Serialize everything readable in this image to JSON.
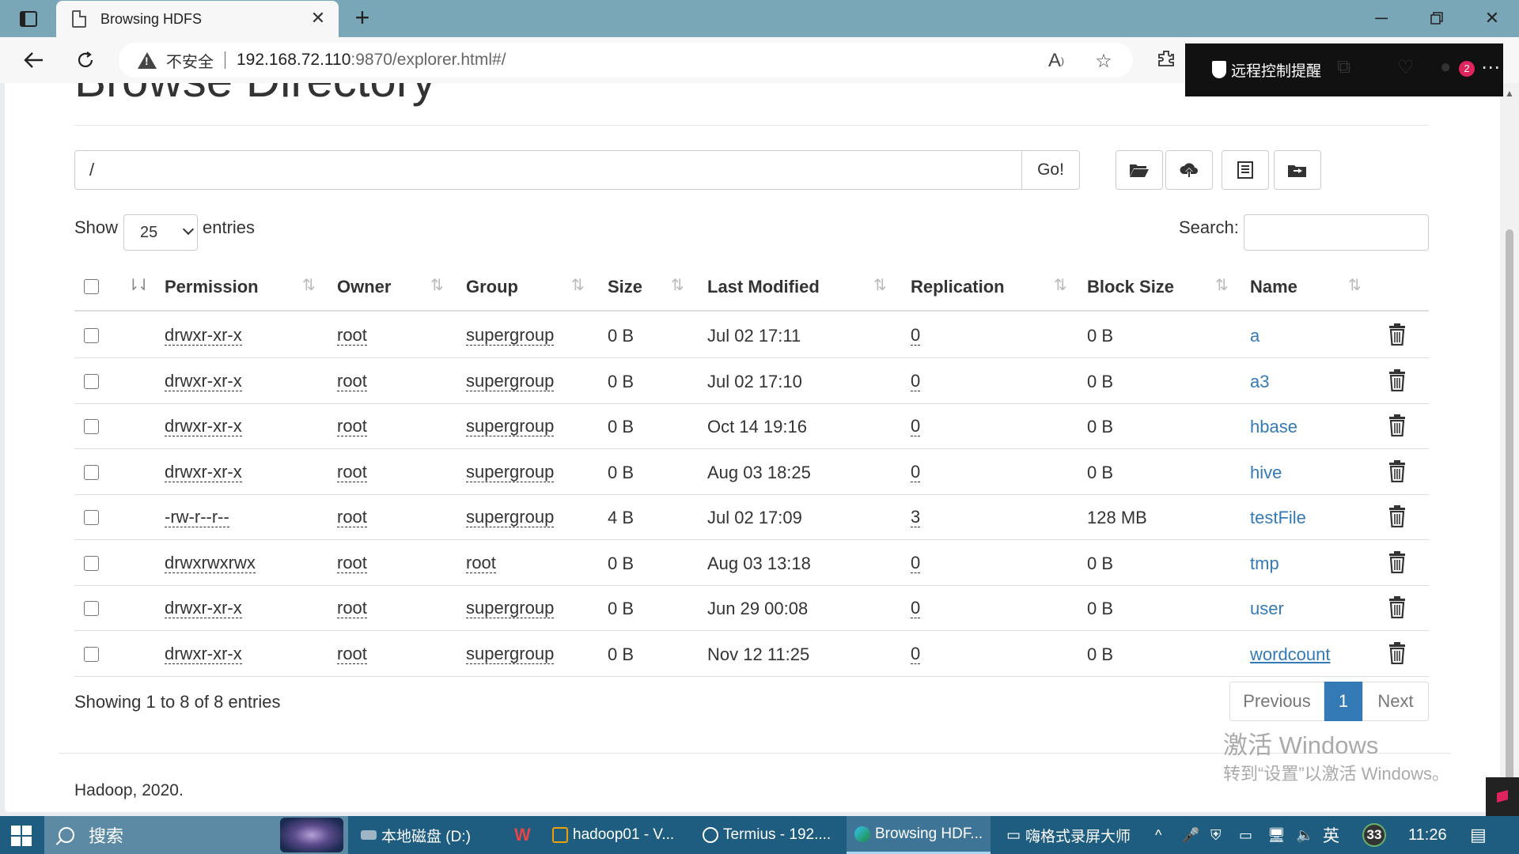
{
  "browser": {
    "tab_title": "Browsing HDFS",
    "insecure_label": "不安全",
    "url_host": "192.168.72.110",
    "url_rest": ":9870/explorer.html#/",
    "remote_toast": "远程控制提醒",
    "notif_count": "2"
  },
  "page": {
    "title": "Browse Directory",
    "path_value": "/",
    "go_label": "Go!",
    "show_label": "Show",
    "page_size": "25",
    "entries_label": "entries",
    "search_label": "Search:",
    "search_value": "",
    "columns": [
      "Permission",
      "Owner",
      "Group",
      "Size",
      "Last Modified",
      "Replication",
      "Block Size",
      "Name"
    ],
    "rows": [
      {
        "permission": "drwxr-xr-x",
        "owner": "root",
        "group": "supergroup",
        "size": "0 B",
        "modified": "Jul 02 17:11",
        "replication": "0",
        "block_size": "0 B",
        "name": "a"
      },
      {
        "permission": "drwxr-xr-x",
        "owner": "root",
        "group": "supergroup",
        "size": "0 B",
        "modified": "Jul 02 17:10",
        "replication": "0",
        "block_size": "0 B",
        "name": "a3"
      },
      {
        "permission": "drwxr-xr-x",
        "owner": "root",
        "group": "supergroup",
        "size": "0 B",
        "modified": "Oct 14 19:16",
        "replication": "0",
        "block_size": "0 B",
        "name": "hbase"
      },
      {
        "permission": "drwxr-xr-x",
        "owner": "root",
        "group": "supergroup",
        "size": "0 B",
        "modified": "Aug 03 18:25",
        "replication": "0",
        "block_size": "0 B",
        "name": "hive"
      },
      {
        "permission": "-rw-r--r--",
        "owner": "root",
        "group": "supergroup",
        "size": "4 B",
        "modified": "Jul 02 17:09",
        "replication": "3",
        "block_size": "128 MB",
        "name": "testFile"
      },
      {
        "permission": "drwxrwxrwx",
        "owner": "root",
        "group": "root",
        "size": "0 B",
        "modified": "Aug 03 13:18",
        "replication": "0",
        "block_size": "0 B",
        "name": "tmp"
      },
      {
        "permission": "drwxr-xr-x",
        "owner": "root",
        "group": "supergroup",
        "size": "0 B",
        "modified": "Jun 29 00:08",
        "replication": "0",
        "block_size": "0 B",
        "name": "user"
      },
      {
        "permission": "drwxr-xr-x",
        "owner": "root",
        "group": "supergroup",
        "size": "0 B",
        "modified": "Nov 12 11:25",
        "replication": "0",
        "block_size": "0 B",
        "name": "wordcount"
      }
    ],
    "showing_text": "Showing 1 to 8 of 8 entries",
    "pager": {
      "previous": "Previous",
      "current": "1",
      "next": "Next"
    },
    "footer": "Hadoop, 2020.",
    "watermark_line1": "激活 Windows",
    "watermark_line2": "转到“设置”以激活 Windows。"
  },
  "taskbar": {
    "search_placeholder": "搜索",
    "items": [
      "本地磁盘 (D:)",
      "hadoop01 - V...",
      "Termius - 192....",
      "Browsing HDF...",
      "嗨格式录屏大师"
    ],
    "ime": "英",
    "badge": "33",
    "clock": "11:26"
  },
  "colors": {
    "link": "#337ab7",
    "tabbar": "#7aa7b7",
    "taskbar": "#1e5d80"
  }
}
